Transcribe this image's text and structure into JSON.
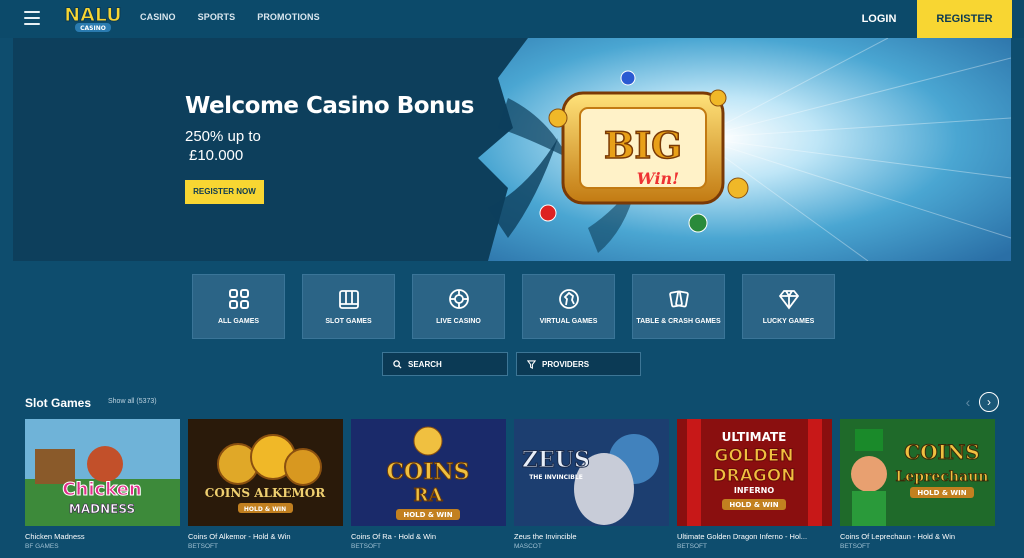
{
  "header": {
    "logo_text": "NALU",
    "logo_sub": "CASINO",
    "nav": [
      "Casino",
      "Sports",
      "Promotions"
    ],
    "login_label": "LOGIN",
    "register_label": "REGISTER"
  },
  "hero": {
    "title": "Welcome Casino Bonus",
    "line1": "250% up to",
    "line2": "£10.000",
    "cta": "Register Now",
    "art_text": "BIG",
    "art_text2": "Win!"
  },
  "categories": [
    {
      "label": "All Games",
      "icon": "grid-icon"
    },
    {
      "label": "Slot Games",
      "icon": "slot-machine-icon"
    },
    {
      "label": "Live Casino",
      "icon": "roulette-icon"
    },
    {
      "label": "Virtual Games",
      "icon": "horse-head-icon"
    },
    {
      "label": "Table & Crash Games",
      "icon": "cards-icon"
    },
    {
      "label": "Lucky Games",
      "icon": "diamond-icon"
    }
  ],
  "search": {
    "label": "Search"
  },
  "providers": {
    "label": "Providers"
  },
  "slot_section": {
    "title": "Slot Games",
    "show_all": "Show all (5373)"
  },
  "games": [
    {
      "name": "Chicken Madness",
      "provider": "BF GAMES",
      "art": "Chicken\nMADNESS",
      "bg": "#3d8a3a"
    },
    {
      "name": "Coins Of Alkemor - Hold & Win",
      "provider": "BETSOFT",
      "art": "COINS ALKEMOR",
      "bg": "#2a1a0a"
    },
    {
      "name": "Coins Of Ra - Hold & Win",
      "provider": "BETSOFT",
      "art": "COINS RA",
      "bg": "#1a2a6a"
    },
    {
      "name": "Zeus the Invincible",
      "provider": "MASCOT",
      "art": "ZEUS",
      "bg": "#1c3e70"
    },
    {
      "name": "Ultimate Golden Dragon Inferno - Hol...",
      "provider": "BETSOFT",
      "art": "ULTIMATE GOLDEN DRAGON",
      "bg": "#8a0f0f"
    },
    {
      "name": "Coins Of Leprechaun - Hold & Win",
      "provider": "BETSOFT",
      "art": "COINS Leprechaun",
      "bg": "#1f6a2a"
    }
  ],
  "colors": {
    "accent": "#f8d632",
    "background": "#0e4d6e",
    "tile": "#2b6486"
  }
}
